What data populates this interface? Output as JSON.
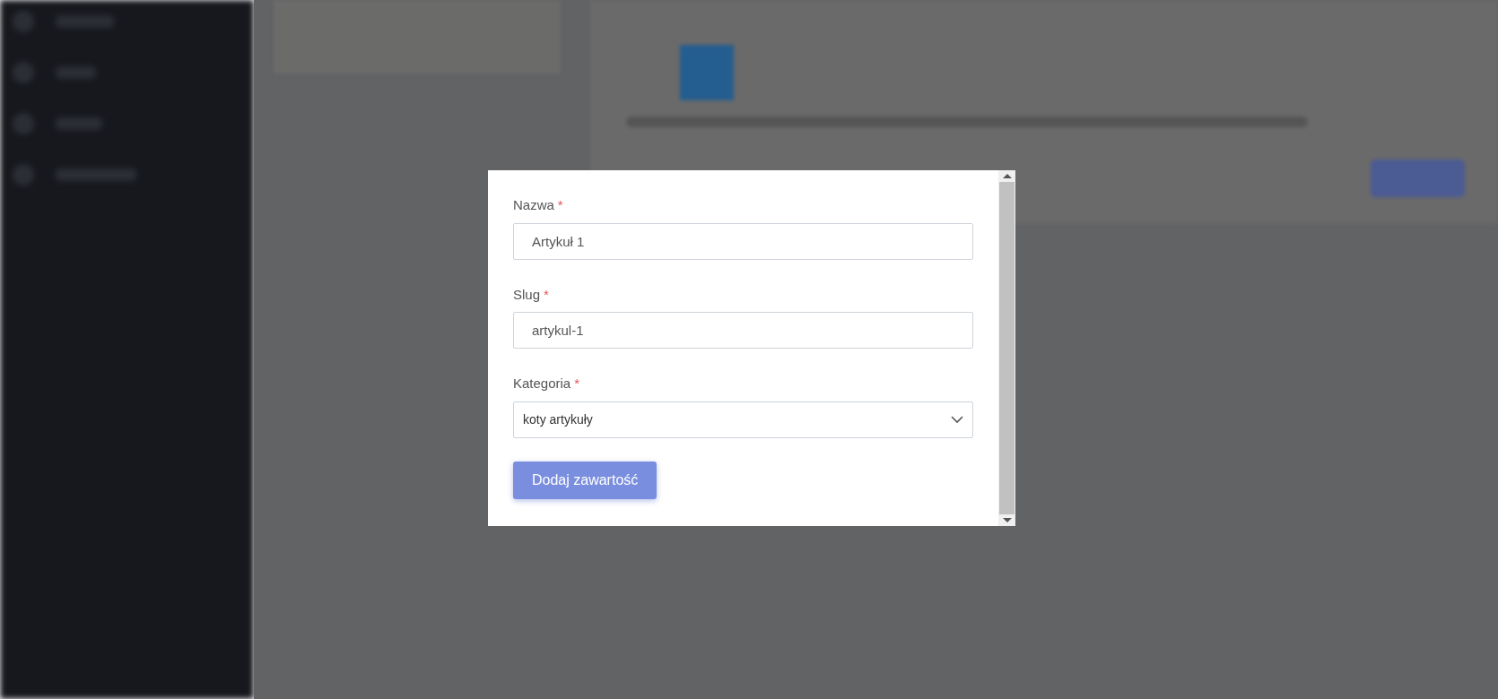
{
  "dialog": {
    "fields": [
      {
        "kind": "text",
        "label": "Nazwa",
        "required_mark": "*",
        "value": "Artykuł 1"
      },
      {
        "kind": "text",
        "label": "Slug",
        "required_mark": "*",
        "value": "artykul-1"
      },
      {
        "kind": "select",
        "label": "Kategoria",
        "required_mark": "*",
        "value": "koty artykuły"
      }
    ],
    "submit_button": {
      "label": "Dodaj zawartość"
    }
  }
}
